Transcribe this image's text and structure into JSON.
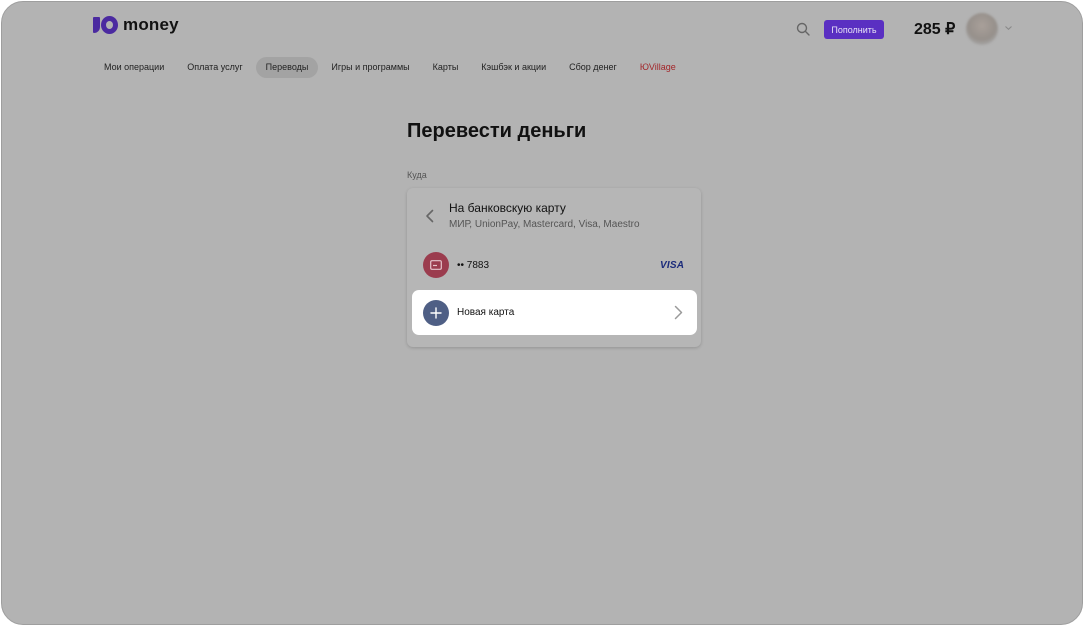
{
  "header": {
    "logo_text": "money",
    "topup_label": "Пополнить",
    "balance": "285 ₽"
  },
  "nav": {
    "items": [
      {
        "label": "Мои операции"
      },
      {
        "label": "Оплата услуг"
      },
      {
        "label": "Переводы",
        "active": true
      },
      {
        "label": "Игры и программы"
      },
      {
        "label": "Карты"
      },
      {
        "label": "Кэшбэк и акции"
      },
      {
        "label": "Сбор денег"
      },
      {
        "label": "ЮVillage"
      }
    ]
  },
  "main": {
    "title": "Перевести деньги",
    "to_label": "Куда",
    "method": {
      "title": "На банковскую карту",
      "subtitle": "МИР, UnionPay, Mastercard, Visa, Maestro"
    },
    "saved_card": {
      "number": "•• 7883",
      "brand": "VISA"
    },
    "new_card_label": "Новая карта"
  },
  "colors": {
    "accent": "#5a2fc2",
    "overlay": "#b3b3b3",
    "saved_card_icon": "#9b3c4e",
    "new_card_icon": "#4f5f85",
    "special_nav": "#a3272b"
  },
  "icons": [
    "search-icon",
    "chevron-down-icon",
    "back-chevron-icon",
    "credit-card-icon",
    "visa-logo",
    "plus-icon",
    "chevron-right-icon"
  ]
}
